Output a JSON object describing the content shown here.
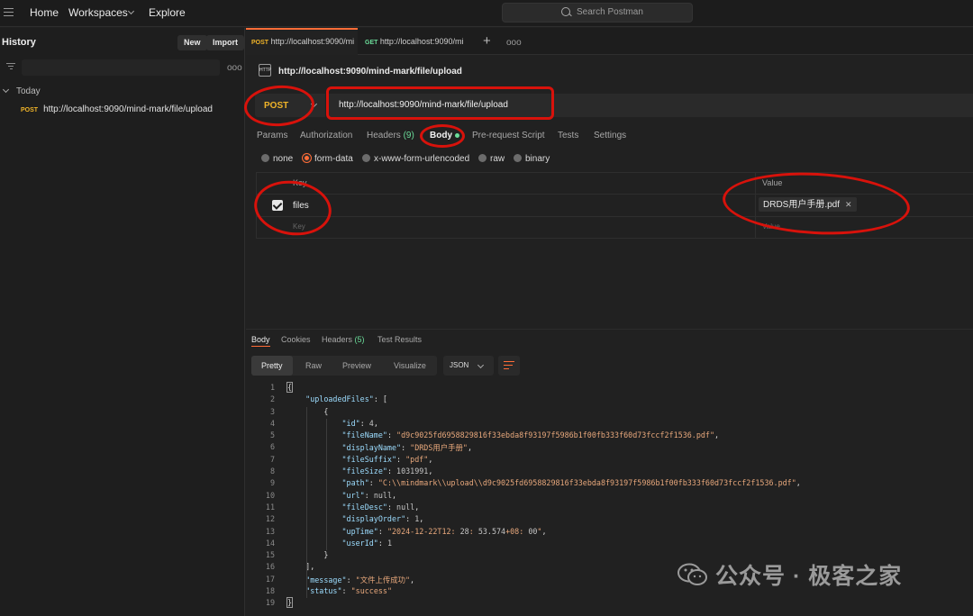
{
  "topbar": {
    "home": "Home",
    "workspaces": "Workspaces",
    "explore": "Explore",
    "search_placeholder": "Search Postman"
  },
  "sidebar": {
    "title": "History",
    "new_label": "New",
    "import_label": "Import",
    "more": "ooo",
    "group_label": "Today",
    "items": [
      {
        "method": "POST",
        "url": "http://localhost:9090/mind-mark/file/upload"
      }
    ]
  },
  "tabs": [
    {
      "method": "POST",
      "label": "http://localhost:9090/mi"
    },
    {
      "method": "GET",
      "label": "http://localhost:9090/mi"
    }
  ],
  "tab_add": "+",
  "tab_more": "ooo",
  "request": {
    "title": "http://localhost:9090/mind-mark/file/upload",
    "method": "POST",
    "url": "http://localhost:9090/mind-mark/file/upload",
    "subtabs": {
      "params": "Params",
      "authorization": "Authorization",
      "headers": "Headers",
      "headers_count": "(9)",
      "body": "Body",
      "pre_request": "Pre-request Script",
      "tests": "Tests",
      "settings": "Settings"
    },
    "body_modes": [
      "none",
      "form-data",
      "x-www-form-urlencoded",
      "raw",
      "binary"
    ],
    "selected_mode": "form-data",
    "table": {
      "key_header": "Key",
      "value_header": "Value",
      "row_key": "files",
      "row_file": "DRDS用户手册.pdf",
      "key_placeholder": "Key",
      "value_placeholder": "Value"
    }
  },
  "response": {
    "tabs": {
      "body": "Body",
      "cookies": "Cookies",
      "headers": "Headers",
      "headers_count": "(5)",
      "test_results": "Test Results"
    },
    "views": {
      "pretty": "Pretty",
      "raw": "Raw",
      "preview": "Preview",
      "visualize": "Visualize"
    },
    "format": "JSON",
    "lines": [
      "{",
      "    \"uploadedFiles\": [",
      "        {",
      "            \"id\": 4,",
      "            \"fileName\": \"d9c9025fd6958829816f33ebda8f93197f5986b1f00fb333f60d73fccf2f1536.pdf\",",
      "            \"displayName\": \"DRDS用户手册\",",
      "            \"fileSuffix\": \"pdf\",",
      "            \"fileSize\": 1031991,",
      "            \"path\": \"C:\\\\mindmark\\\\upload\\\\d9c9025fd6958829816f33ebda8f93197f5986b1f00fb333f60d73fccf2f1536.pdf\",",
      "            \"url\": null,",
      "            \"fileDesc\": null,",
      "            \"displayOrder\": 1,",
      "            \"upTime\": \"2024-12-22T12:28:53.574+08:00\",",
      "            \"userId\": 1",
      "        }",
      "    ],",
      "    \"message\": \"文件上传成功\",",
      "    \"status\": \"success\"",
      "}"
    ]
  },
  "watermark": "公众号 · 极客之家",
  "colors": {
    "accent": "#ff6c37",
    "post": "#f0b429",
    "get": "#6bdd9a",
    "annotation": "#d8120b"
  }
}
